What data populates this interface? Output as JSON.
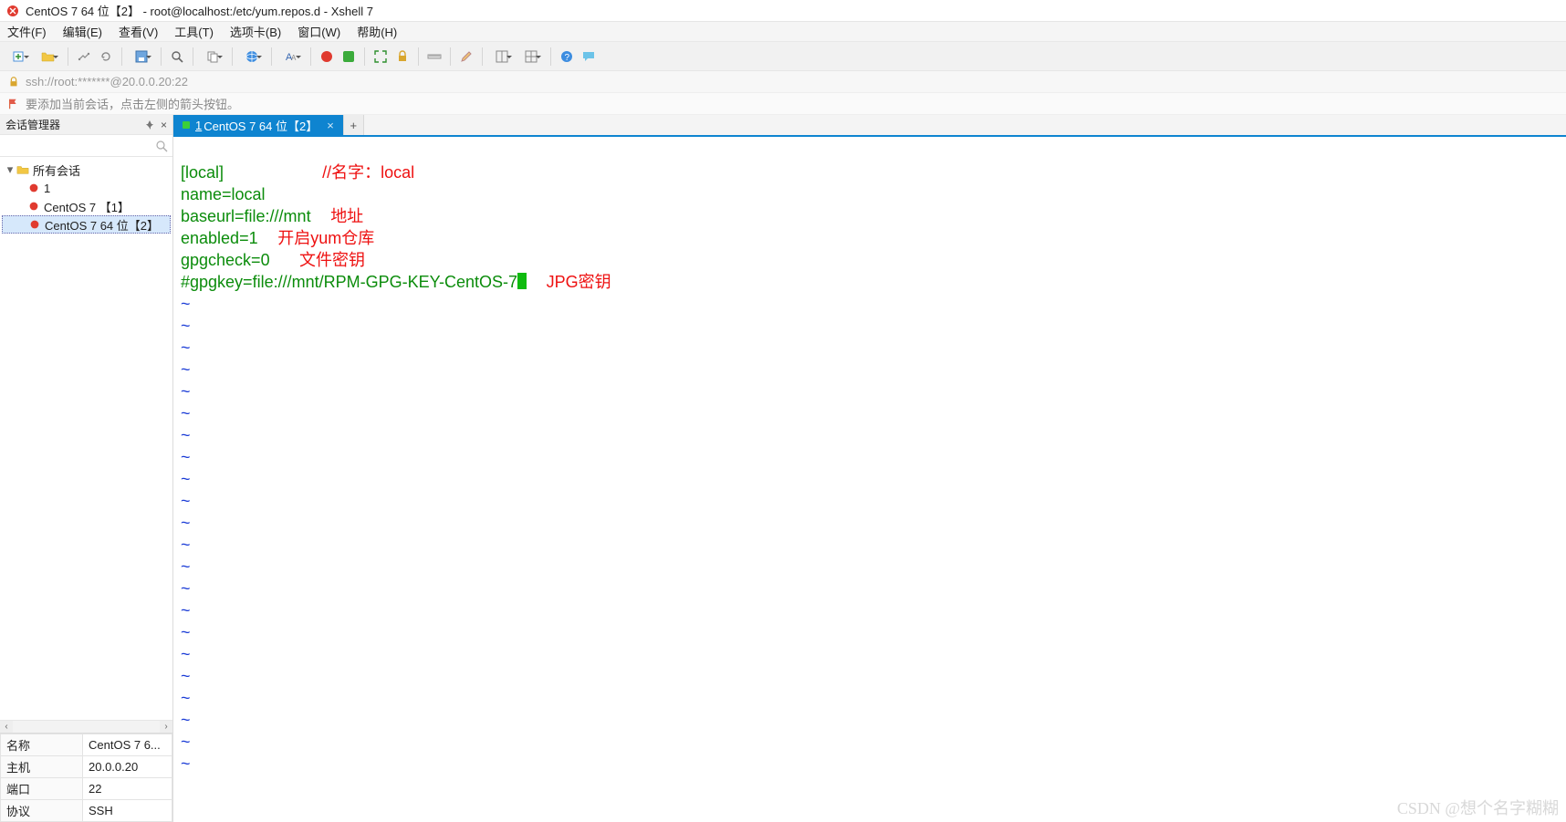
{
  "title": "CentOS 7 64 位【2】  - root@localhost:/etc/yum.repos.d - Xshell 7",
  "menu": {
    "file": "文件(F)",
    "edit": "编辑(E)",
    "view": "查看(V)",
    "tools": "工具(T)",
    "tabs": "选项卡(B)",
    "window": "窗口(W)",
    "help": "帮助(H)"
  },
  "addr": "ssh://root:*******@20.0.0.20:22",
  "hint": "要添加当前会话，点击左侧的箭头按钮。",
  "sidebar": {
    "title": "会话管理器",
    "search_placeholder": "",
    "root": "所有会话",
    "items": [
      {
        "label": "1"
      },
      {
        "label": "CentOS 7 【1】"
      },
      {
        "label": "CentOS 7 64 位【2】",
        "selected": true
      }
    ]
  },
  "properties": [
    {
      "k": "名称",
      "v": "CentOS 7 6..."
    },
    {
      "k": "主机",
      "v": "20.0.0.20"
    },
    {
      "k": "端口",
      "v": "22"
    },
    {
      "k": "协议",
      "v": "SSH"
    }
  ],
  "tab": {
    "index": "1",
    "label": "CentOS 7 64 位【2】"
  },
  "term": {
    "l1": "[local]",
    "a1": "//名字：local",
    "l2": "name=local",
    "l3": "baseurl=file:///mnt",
    "a3": "地址",
    "l4": "enabled=1",
    "a4": "开启yum仓库",
    "l5": "gpgcheck=0",
    "a5": "文件密钥",
    "l6": "#gpgkey=file:///mnt/RPM-GPG-KEY-CentOS-7",
    "a6": "JPG密钥",
    "tilde": "~"
  },
  "watermark": "CSDN @想个名字糊糊"
}
